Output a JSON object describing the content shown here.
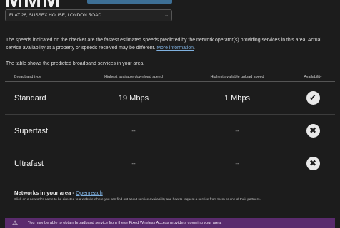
{
  "header": {
    "title_fragment": "MMM"
  },
  "address": {
    "selected": "FLAT 26, SUSSEX HOUSE, LONDON ROAD"
  },
  "intro": {
    "text": "The speeds indicated on the checker are the fastest estimated speeds predicted by the network operator(s) providing services in this area. Actual service availability at a property or speeds received may be different.",
    "link": "More information",
    "table_caption": "The table shows the predicted broadband services in your area."
  },
  "table": {
    "headers": [
      "Broadband type",
      "Highest available download speed",
      "Highest available upload speed",
      "Availability"
    ],
    "rows": [
      {
        "type": "Standard",
        "download": "19 Mbps",
        "upload": "1 Mbps",
        "available": true,
        "icon": "check-icon",
        "glyph": "✔"
      },
      {
        "type": "Superfast",
        "download": "--",
        "upload": "--",
        "available": false,
        "icon": "cross-icon",
        "glyph": "✖"
      },
      {
        "type": "Ultrafast",
        "download": "--",
        "upload": "--",
        "available": false,
        "icon": "cross-icon",
        "glyph": "✖"
      }
    ]
  },
  "networks": {
    "heading": "Networks in your area -",
    "link": "Openreach",
    "subtext": "Click on a network's name to be directed to a website where you can find out about service availability and how to request a service from them or one of their partners."
  },
  "notice": {
    "icon": "warning-icon",
    "text": "You may be able to obtain broadband service from these Fixed Wireless Access providers covering your area."
  },
  "colors": {
    "background": "#1c1c1c",
    "accent": "#3d6f95",
    "link": "#7fb1e0",
    "notice": "#5a2b6d"
  }
}
